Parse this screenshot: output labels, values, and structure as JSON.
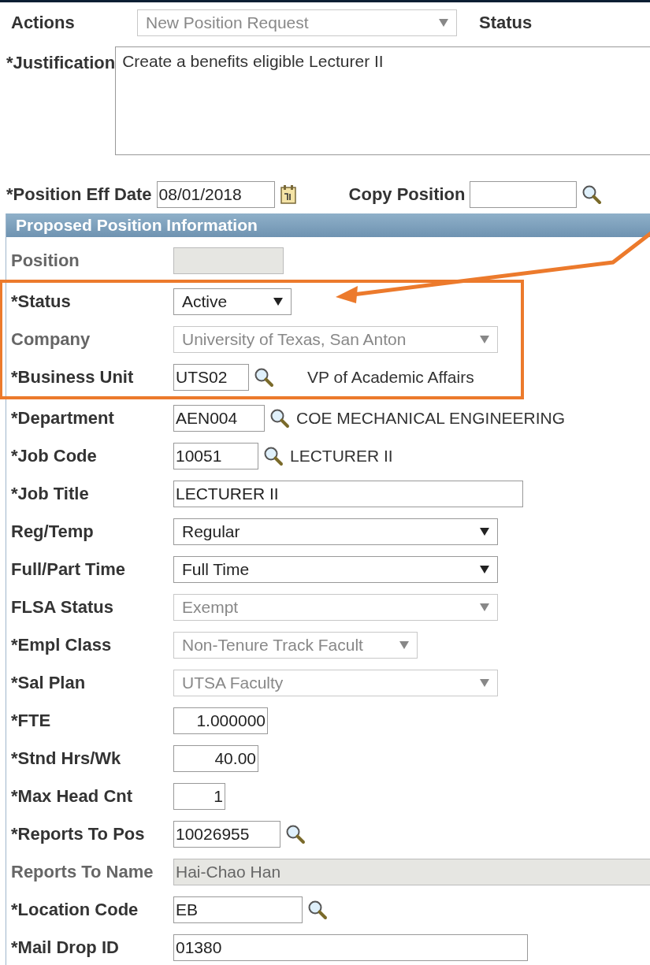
{
  "header": {
    "actions_label": "Actions",
    "actions_value": "New Position Request",
    "actions_disabled": true,
    "status_label": "Status",
    "justification_label": "*Justification",
    "justification_value": "Create a benefits eligible Lecturer II",
    "eff_date_label": "*Position Eff Date",
    "eff_date_value": "08/01/2018",
    "copy_label": "Copy Position"
  },
  "section": {
    "title": "Proposed Position Information",
    "fields": [
      {
        "label": "Position",
        "kind": "readonly",
        "muted": true,
        "highlighted": false
      },
      {
        "label": "*Status",
        "kind": "select",
        "value": "Active",
        "disabled": false,
        "muted": false,
        "highlighted": true
      },
      {
        "label": "Company",
        "kind": "select",
        "value": "University of Texas, San Anton",
        "disabled": true,
        "muted": true,
        "highlighted": true
      },
      {
        "label": "*Business Unit",
        "kind": "lookup",
        "value": "UTS02",
        "description": "VP of Academic Affairs",
        "muted": false,
        "highlighted": true
      },
      {
        "label": "*Department",
        "kind": "lookup",
        "value": "AEN004",
        "description": "COE MECHANICAL ENGINEERING",
        "muted": false,
        "highlighted": false
      },
      {
        "label": "*Job Code",
        "kind": "lookup",
        "value": "10051",
        "description": "LECTURER II",
        "muted": false,
        "highlighted": false
      },
      {
        "label": "*Job Title",
        "kind": "text",
        "value": "LECTURER II",
        "muted": false,
        "highlighted": false
      },
      {
        "label": "Reg/Temp",
        "kind": "select",
        "value": "Regular",
        "disabled": false,
        "muted": false,
        "highlighted": false
      },
      {
        "label": "Full/Part Time",
        "kind": "select",
        "value": "Full Time",
        "disabled": false,
        "muted": false,
        "highlighted": false
      },
      {
        "label": "FLSA Status",
        "kind": "select",
        "value": "Exempt",
        "disabled": true,
        "muted": false,
        "highlighted": false
      },
      {
        "label": "*Empl Class",
        "kind": "select",
        "value": "Non-Tenure Track Facult",
        "disabled": true,
        "muted": false,
        "highlighted": false
      },
      {
        "label": "*Sal Plan",
        "kind": "select",
        "value": "UTSA Faculty",
        "disabled": true,
        "muted": false,
        "highlighted": false
      },
      {
        "label": "*FTE",
        "kind": "number",
        "value": "1.000000",
        "muted": false,
        "highlighted": false
      },
      {
        "label": "*Stnd Hrs/Wk",
        "kind": "number",
        "value": "40.00",
        "muted": false,
        "highlighted": false
      },
      {
        "label": "*Max Head Cnt",
        "kind": "number",
        "value": "1",
        "muted": false,
        "highlighted": false
      },
      {
        "label": "*Reports To Pos",
        "kind": "lookup",
        "value": "10026955",
        "muted": false,
        "highlighted": false
      },
      {
        "label": "Reports To Name",
        "kind": "readonly",
        "value": "Hai-Chao Han",
        "muted": true,
        "highlighted": false
      },
      {
        "label": "*Location Code",
        "kind": "lookup",
        "value": "EB",
        "muted": false,
        "highlighted": false
      },
      {
        "label": "*Mail Drop ID",
        "kind": "text",
        "value": "01380",
        "muted": false,
        "highlighted": false
      }
    ]
  }
}
